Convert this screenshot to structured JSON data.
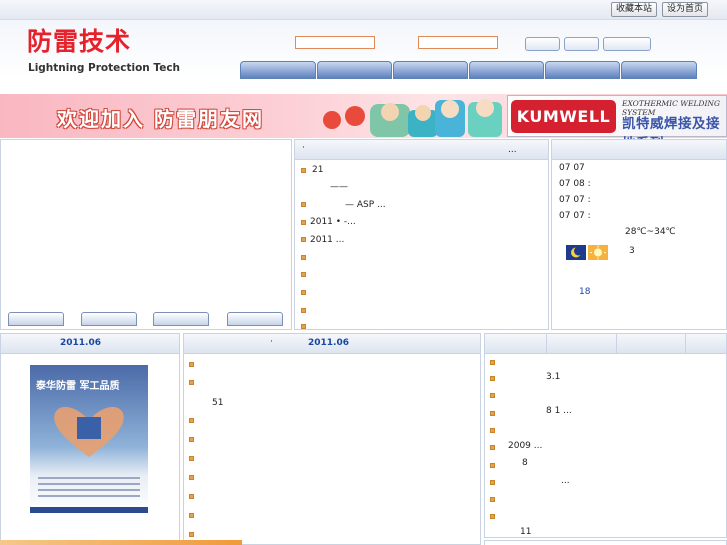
{
  "topbar": {
    "bookmark_label": "收藏本站",
    "homepage_label": "设为首页"
  },
  "logo": {
    "cn": "防雷技术",
    "en": "Lightning Protection Tech"
  },
  "banner": {
    "welcome_text": "欢迎加入 防雷朋友网",
    "ad_brand": "KUMWELL",
    "ad_english": "EXOTHERMIC WELDING SYSTEM",
    "ad_chinese": "凯特威焊接及接地系列"
  },
  "news_panel": {
    "header_dot": "·",
    "header_more": "...",
    "items": [
      {
        "text": "21"
      },
      {
        "text": "——"
      },
      {
        "text": "—      ASP   ..."
      },
      {
        "text": "2011  •            -..."
      },
      {
        "text": "2011                    ..."
      },
      {
        "text": ""
      },
      {
        "text": ""
      },
      {
        "text": ""
      },
      {
        "text": ""
      }
    ]
  },
  "weather_panel": {
    "lines": [
      "07 07",
      "07 08 :",
      "07 07 :",
      "07 07 :"
    ],
    "temperature": "28℃~34℃",
    "level": "3",
    "day": "18",
    "icons": [
      "moon-icon",
      "sun-icon"
    ]
  },
  "bottom_left": {
    "title": "2011.06",
    "poster_title": "泰华防雷 军工品质"
  },
  "bottom_mid": {
    "title_dot": "·",
    "title": "2011.06",
    "items": [
      "",
      "",
      "51",
      "",
      "",
      "",
      "",
      "",
      ""
    ]
  },
  "bottom_right": {
    "items": [
      "",
      "3.1",
      "",
      "8 1  ...",
      "",
      "2009          ...",
      "8",
      "...",
      "",
      "",
      "11"
    ]
  }
}
